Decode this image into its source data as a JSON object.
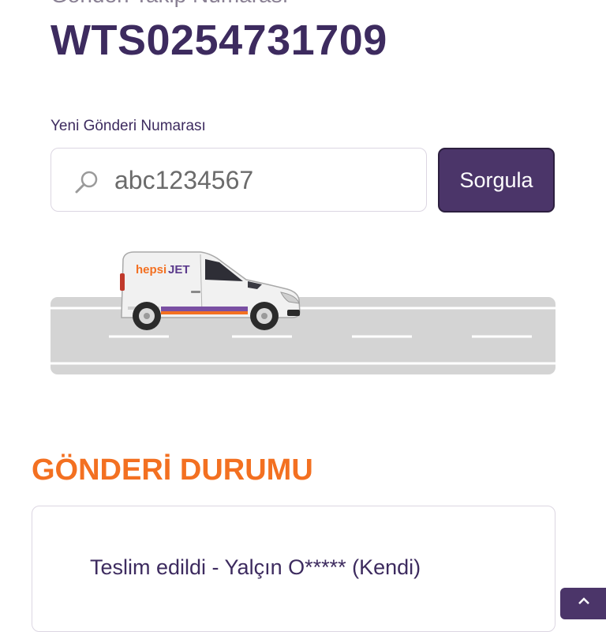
{
  "tracking": {
    "label": "Gönderi Takip Numarası",
    "number": "WTS0254731709"
  },
  "search": {
    "label": "Yeni Gönderi Numarası",
    "value": "abc1234567",
    "icon": "search-icon",
    "button_label": "Sorgula"
  },
  "illustration": {
    "brand_prefix": "hepsi",
    "brand_suffix": "JET"
  },
  "status": {
    "title": "GÖNDERİ DURUMU",
    "text": "Teslim edildi - Yalçın O***** (Kendi)"
  },
  "colors": {
    "brand_purple": "#4b3569",
    "heading_purple": "#3d2b5f",
    "accent_orange": "#f37021",
    "road_gray": "#d4d4d4"
  }
}
